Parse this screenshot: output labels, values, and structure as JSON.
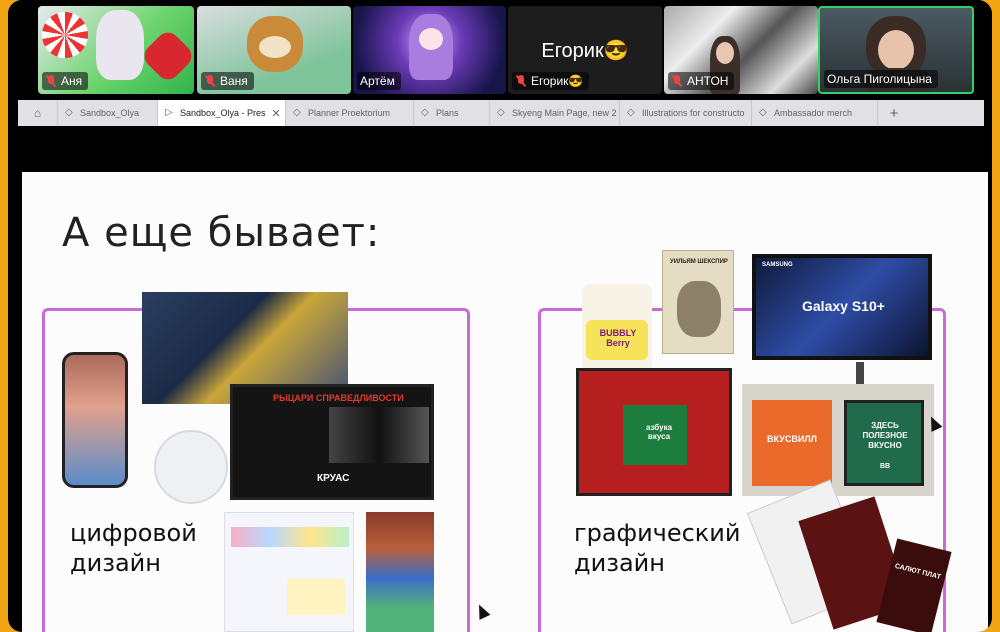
{
  "participants": [
    {
      "name": "Аня"
    },
    {
      "name": "Ваня"
    },
    {
      "name": "Артём"
    },
    {
      "name": "Егорик😎",
      "display_name": "Егорик😎"
    },
    {
      "name": "АНТОН"
    },
    {
      "name": "Ольга Пиголицына"
    }
  ],
  "tabs": [
    {
      "label": "Sandbox_Olya",
      "active": false
    },
    {
      "label": "Sandbox_Olya - Pres",
      "active": true
    },
    {
      "label": "Planner Proektorium",
      "active": false
    },
    {
      "label": "Plans",
      "active": false
    },
    {
      "label": "Skyeng Main Page, new 2",
      "active": false
    },
    {
      "label": "Illustrations for constructo",
      "active": false
    },
    {
      "label": "Ambassador merch",
      "active": false
    }
  ],
  "new_tab_label": "+",
  "slide": {
    "title": "А еще бывает:",
    "left_caption": "цифровой\nдизайн",
    "right_caption": "графический\nдизайн",
    "images": {
      "tv_title": "РЫЦАРИ СПРАВЕДЛИВОСТИ",
      "tv_tag": "КРУАС",
      "book_title": "УИЛЬЯМ ШЕКСПИР",
      "candle_text": "BUBBLY Berry",
      "billboard_text": "Galaxy S10+",
      "billboard_brand": "SAMSUNG",
      "gift_text": "азбука вкуса",
      "poster_brand": "ВКУСВИЛЛ",
      "poster_text": "ЗДЕСЬ ПОЛЕЗНОЕ ВКУСНО",
      "poster_tag": "ВВ",
      "flyer_text": "САЛЮТ ПЛАТ"
    }
  },
  "colors": {
    "frame_bg": "#f3a614",
    "frame_accent": "#c86bd8",
    "active_speaker": "#35d05d"
  }
}
